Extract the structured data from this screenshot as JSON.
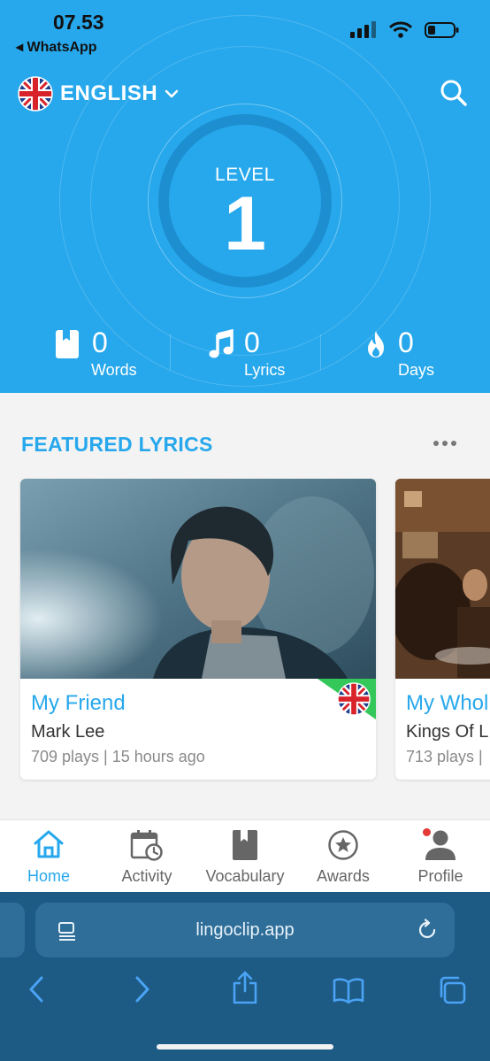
{
  "status_bar": {
    "time": "07.53",
    "back_app": "◂ WhatsApp"
  },
  "header": {
    "language": "ENGLISH"
  },
  "level": {
    "label": "LEVEL",
    "value": "1"
  },
  "stats": [
    {
      "value": "0",
      "label": "Words",
      "icon": "book-icon"
    },
    {
      "value": "0",
      "label": "Lyrics",
      "icon": "music-note-icon"
    },
    {
      "value": "0",
      "label": "Days",
      "icon": "flame-icon"
    }
  ],
  "featured": {
    "title": "FEATURED LYRICS",
    "cards": [
      {
        "title": "My Friend",
        "artist": "Mark Lee",
        "meta": "709 plays | 15 hours ago",
        "language_flag": "uk-flag-icon"
      },
      {
        "title": "My Whol",
        "artist": "Kings Of L",
        "meta": "713 plays |"
      }
    ]
  },
  "tabs": [
    {
      "label": "Home",
      "icon": "home-icon",
      "active": true
    },
    {
      "label": "Activity",
      "icon": "calendar-clock-icon",
      "active": false
    },
    {
      "label": "Vocabulary",
      "icon": "book-icon",
      "active": false
    },
    {
      "label": "Awards",
      "icon": "star-medal-icon",
      "active": false
    },
    {
      "label": "Profile",
      "icon": "user-icon",
      "active": false,
      "notification": true
    }
  ],
  "browser": {
    "url": "lingoclip.app"
  },
  "colors": {
    "primary_blue": "#27a8ec",
    "ring_blue": "#1d8fd0",
    "badge_green": "#34c759",
    "browser_bg": "#1d5a84",
    "notification_red": "#e53935"
  }
}
